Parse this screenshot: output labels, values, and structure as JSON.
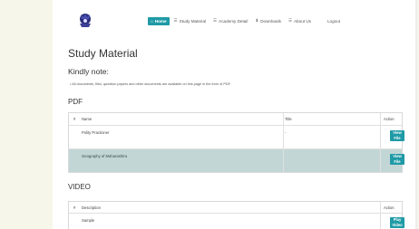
{
  "nav": {
    "items": [
      {
        "icon": "home-icon",
        "glyph": "⌂",
        "label": "Home",
        "active": true
      },
      {
        "icon": "list-icon",
        "glyph": "☰",
        "label": "Study Material",
        "active": false
      },
      {
        "icon": "list-icon",
        "glyph": "☰",
        "label": "Academy Detail",
        "active": false
      },
      {
        "icon": "download-icon",
        "glyph": "⬇",
        "label": "Downloads",
        "active": false
      },
      {
        "icon": "list-icon",
        "glyph": "☰",
        "label": "About Us",
        "active": false
      }
    ],
    "logout": "Logout"
  },
  "page": {
    "title": "Study Material",
    "kindly_note": "Kindly note:",
    "note": "All documents, files, question papers and other documents are available on this page in the form of PDF."
  },
  "pdf": {
    "heading": "PDF",
    "columns": [
      "#",
      "Name",
      "Title",
      "Action"
    ],
    "rows": [
      {
        "name": "Polity Practioner",
        "title": "-",
        "button": [
          "View",
          "File"
        ]
      },
      {
        "name": "Geography of Maharashtra",
        "title": "",
        "button": [
          "View",
          "File"
        ]
      }
    ]
  },
  "video": {
    "heading": "VIDEO",
    "columns": [
      "#",
      "Description",
      "Action"
    ],
    "rows": [
      {
        "description": "Sample",
        "button": [
          "Play",
          "Video"
        ]
      }
    ]
  },
  "colors": {
    "accent": "#1f9aa6",
    "row_alt": "#c3d6d6",
    "background": "#f7f6ea"
  }
}
